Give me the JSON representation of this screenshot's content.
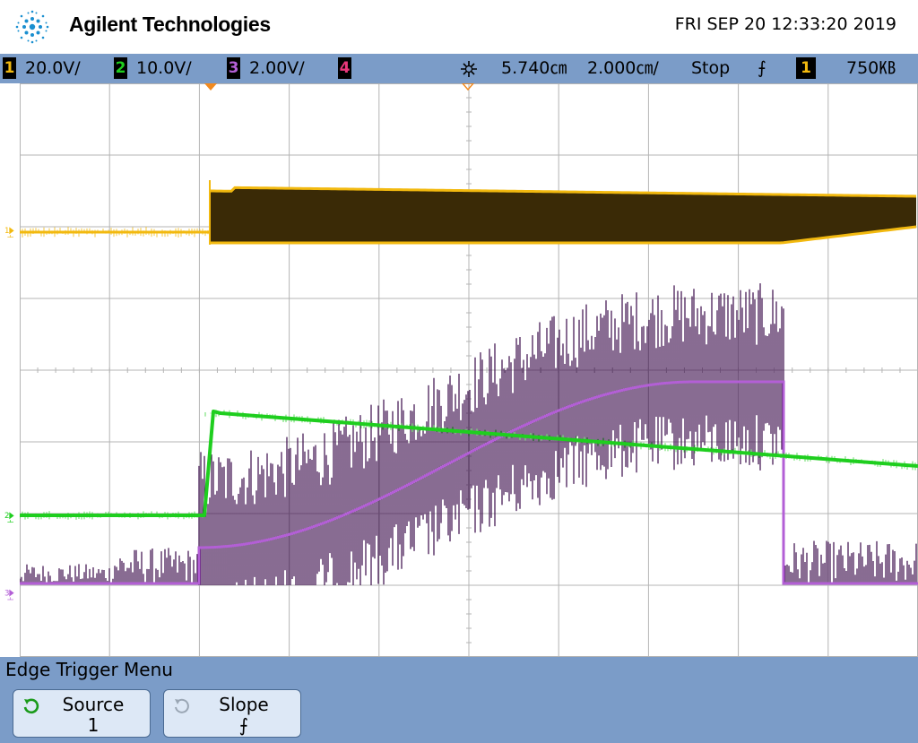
{
  "header": {
    "brand": "Agilent Technologies",
    "datetime": "FRI SEP 20 12:33:20 2019",
    "logo_icon": "agilent-spark-icon"
  },
  "channels": [
    {
      "num": "1",
      "scale": "20.0V/",
      "color": "#f2b90f"
    },
    {
      "num": "2",
      "scale": "10.0V/",
      "color": "#1fce1f"
    },
    {
      "num": "3",
      "scale": "2.00V/",
      "color": "#b35fd6"
    },
    {
      "num": "4",
      "scale": "",
      "color": "#e8377a"
    }
  ],
  "timebase": {
    "delay": "5.740㎝",
    "scale": "2.000㎝/",
    "delay_icon": "delay-icon"
  },
  "run_state": "Stop",
  "trigger": {
    "slope_symbol": "⨍",
    "source": "1",
    "level": "750㎅"
  },
  "menu": {
    "title": "Edge Trigger Menu",
    "softkeys": [
      {
        "label": "Source",
        "value": "1",
        "icon": "rotate-knob-icon",
        "active": true
      },
      {
        "label": "Slope",
        "value": "⨍",
        "icon": "rotate-knob-icon",
        "active": false
      }
    ]
  },
  "colors": {
    "status_bar": "#7b9cc8",
    "grid": "#b4b4b4",
    "ch1_fill": "#3a2a06",
    "ch3_fill": "#3a0a4a"
  }
}
